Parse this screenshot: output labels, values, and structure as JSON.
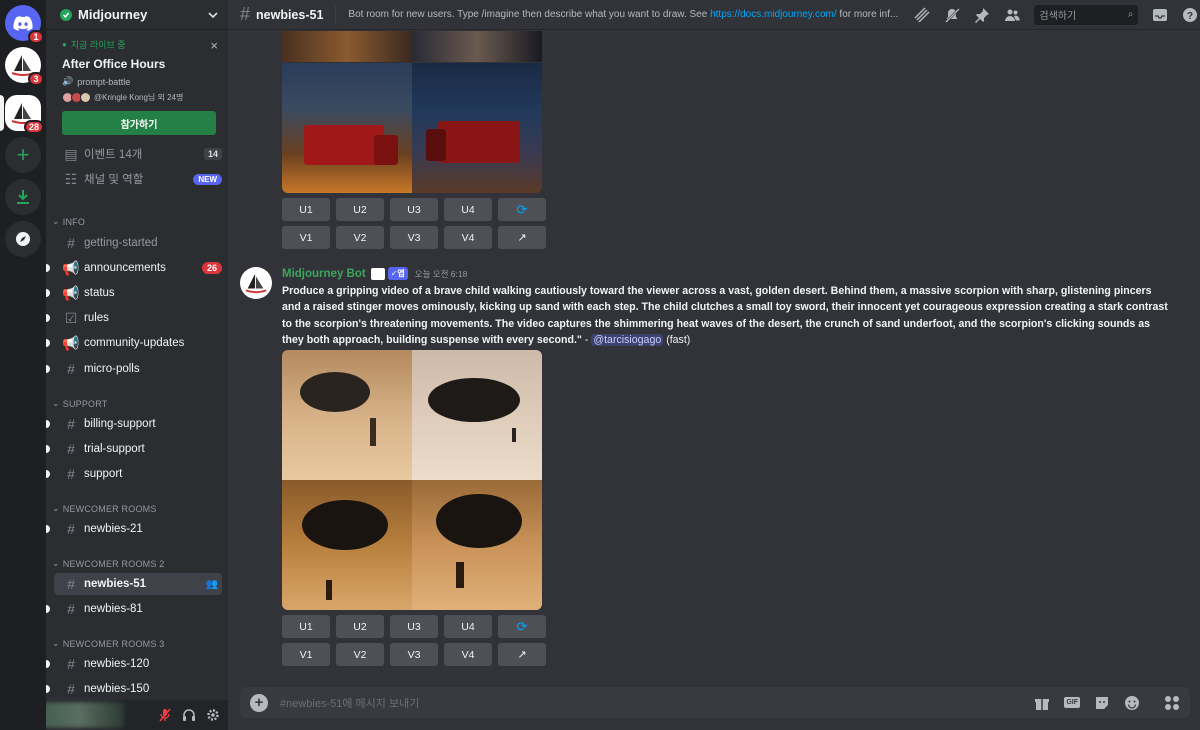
{
  "rail": {
    "dm_badge": "1",
    "server1_badge": "3",
    "server2_badge": "28"
  },
  "server": {
    "name": "Midjourney"
  },
  "live": {
    "status": "지금 라이브 중",
    "title": "After Office Hours",
    "channel": "prompt-battle",
    "participants": "@Kringle Kong님 외 24명",
    "join_label": "참가하기"
  },
  "sidebar": {
    "events_label": "이벤트 14개",
    "events_count": "14",
    "channels_roles_label": "채널 및 역할",
    "new_badge": "NEW",
    "categories": {
      "info": "INFO",
      "support": "SUPPORT",
      "newcomer": "NEWCOMER ROOMS",
      "newcomer2": "NEWCOMER ROOMS 2",
      "newcomer3": "NEWCOMER ROOMS 3"
    },
    "channels": {
      "getting_started": "getting-started",
      "announcements": "announcements",
      "announcements_badge": "26",
      "status": "status",
      "rules": "rules",
      "community_updates": "community-updates",
      "micro_polls": "micro-polls",
      "billing_support": "billing-support",
      "trial_support": "trial-support",
      "support": "support",
      "newbies_21": "newbies-21",
      "newbies_51": "newbies-51",
      "newbies_81": "newbies-81",
      "newbies_120": "newbies-120",
      "newbies_150": "newbies-150"
    }
  },
  "header": {
    "channel": "newbies-51",
    "topic_prefix": "Bot room for new users. Type /imagine then describe what you want to draw. See ",
    "topic_link": "https://docs.midjourney.com/",
    "topic_suffix": " for more inf...",
    "search_placeholder": "검색하기"
  },
  "buttons": {
    "u1": "U1",
    "u2": "U2",
    "u3": "U3",
    "u4": "U4",
    "v1": "V1",
    "v2": "V2",
    "v3": "V3",
    "v4": "V4"
  },
  "message": {
    "author": "Midjourney Bot",
    "app_badge": "✓앱",
    "time": "오늘 오전 6:18",
    "prompt": "Produce a gripping video of a brave child walking cautiously toward the viewer across a vast, golden desert. Behind them, a massive scorpion with sharp, glistening pincers and a raised stinger moves ominously, kicking up sand with each step. The child clutches a small toy sword, their innocent yet courageous expression creating a stark contrast to the scorpion's threatening movements. The video captures the shimmering heat waves of the desert, the crunch of sand underfoot, and the scorpion's clicking sounds as they both approach, building suspense with every second.\"",
    "dash": " - ",
    "mention": "@tarcisiogago",
    "mode": " (fast)"
  },
  "composer": {
    "placeholder": "#newbies-51에 메시지 보내기",
    "gif_label": "GIF"
  },
  "colors": {
    "accent": "#5865f2",
    "online": "#23a55a",
    "bot_name": "#3ba55c",
    "badge": "#da373c"
  }
}
